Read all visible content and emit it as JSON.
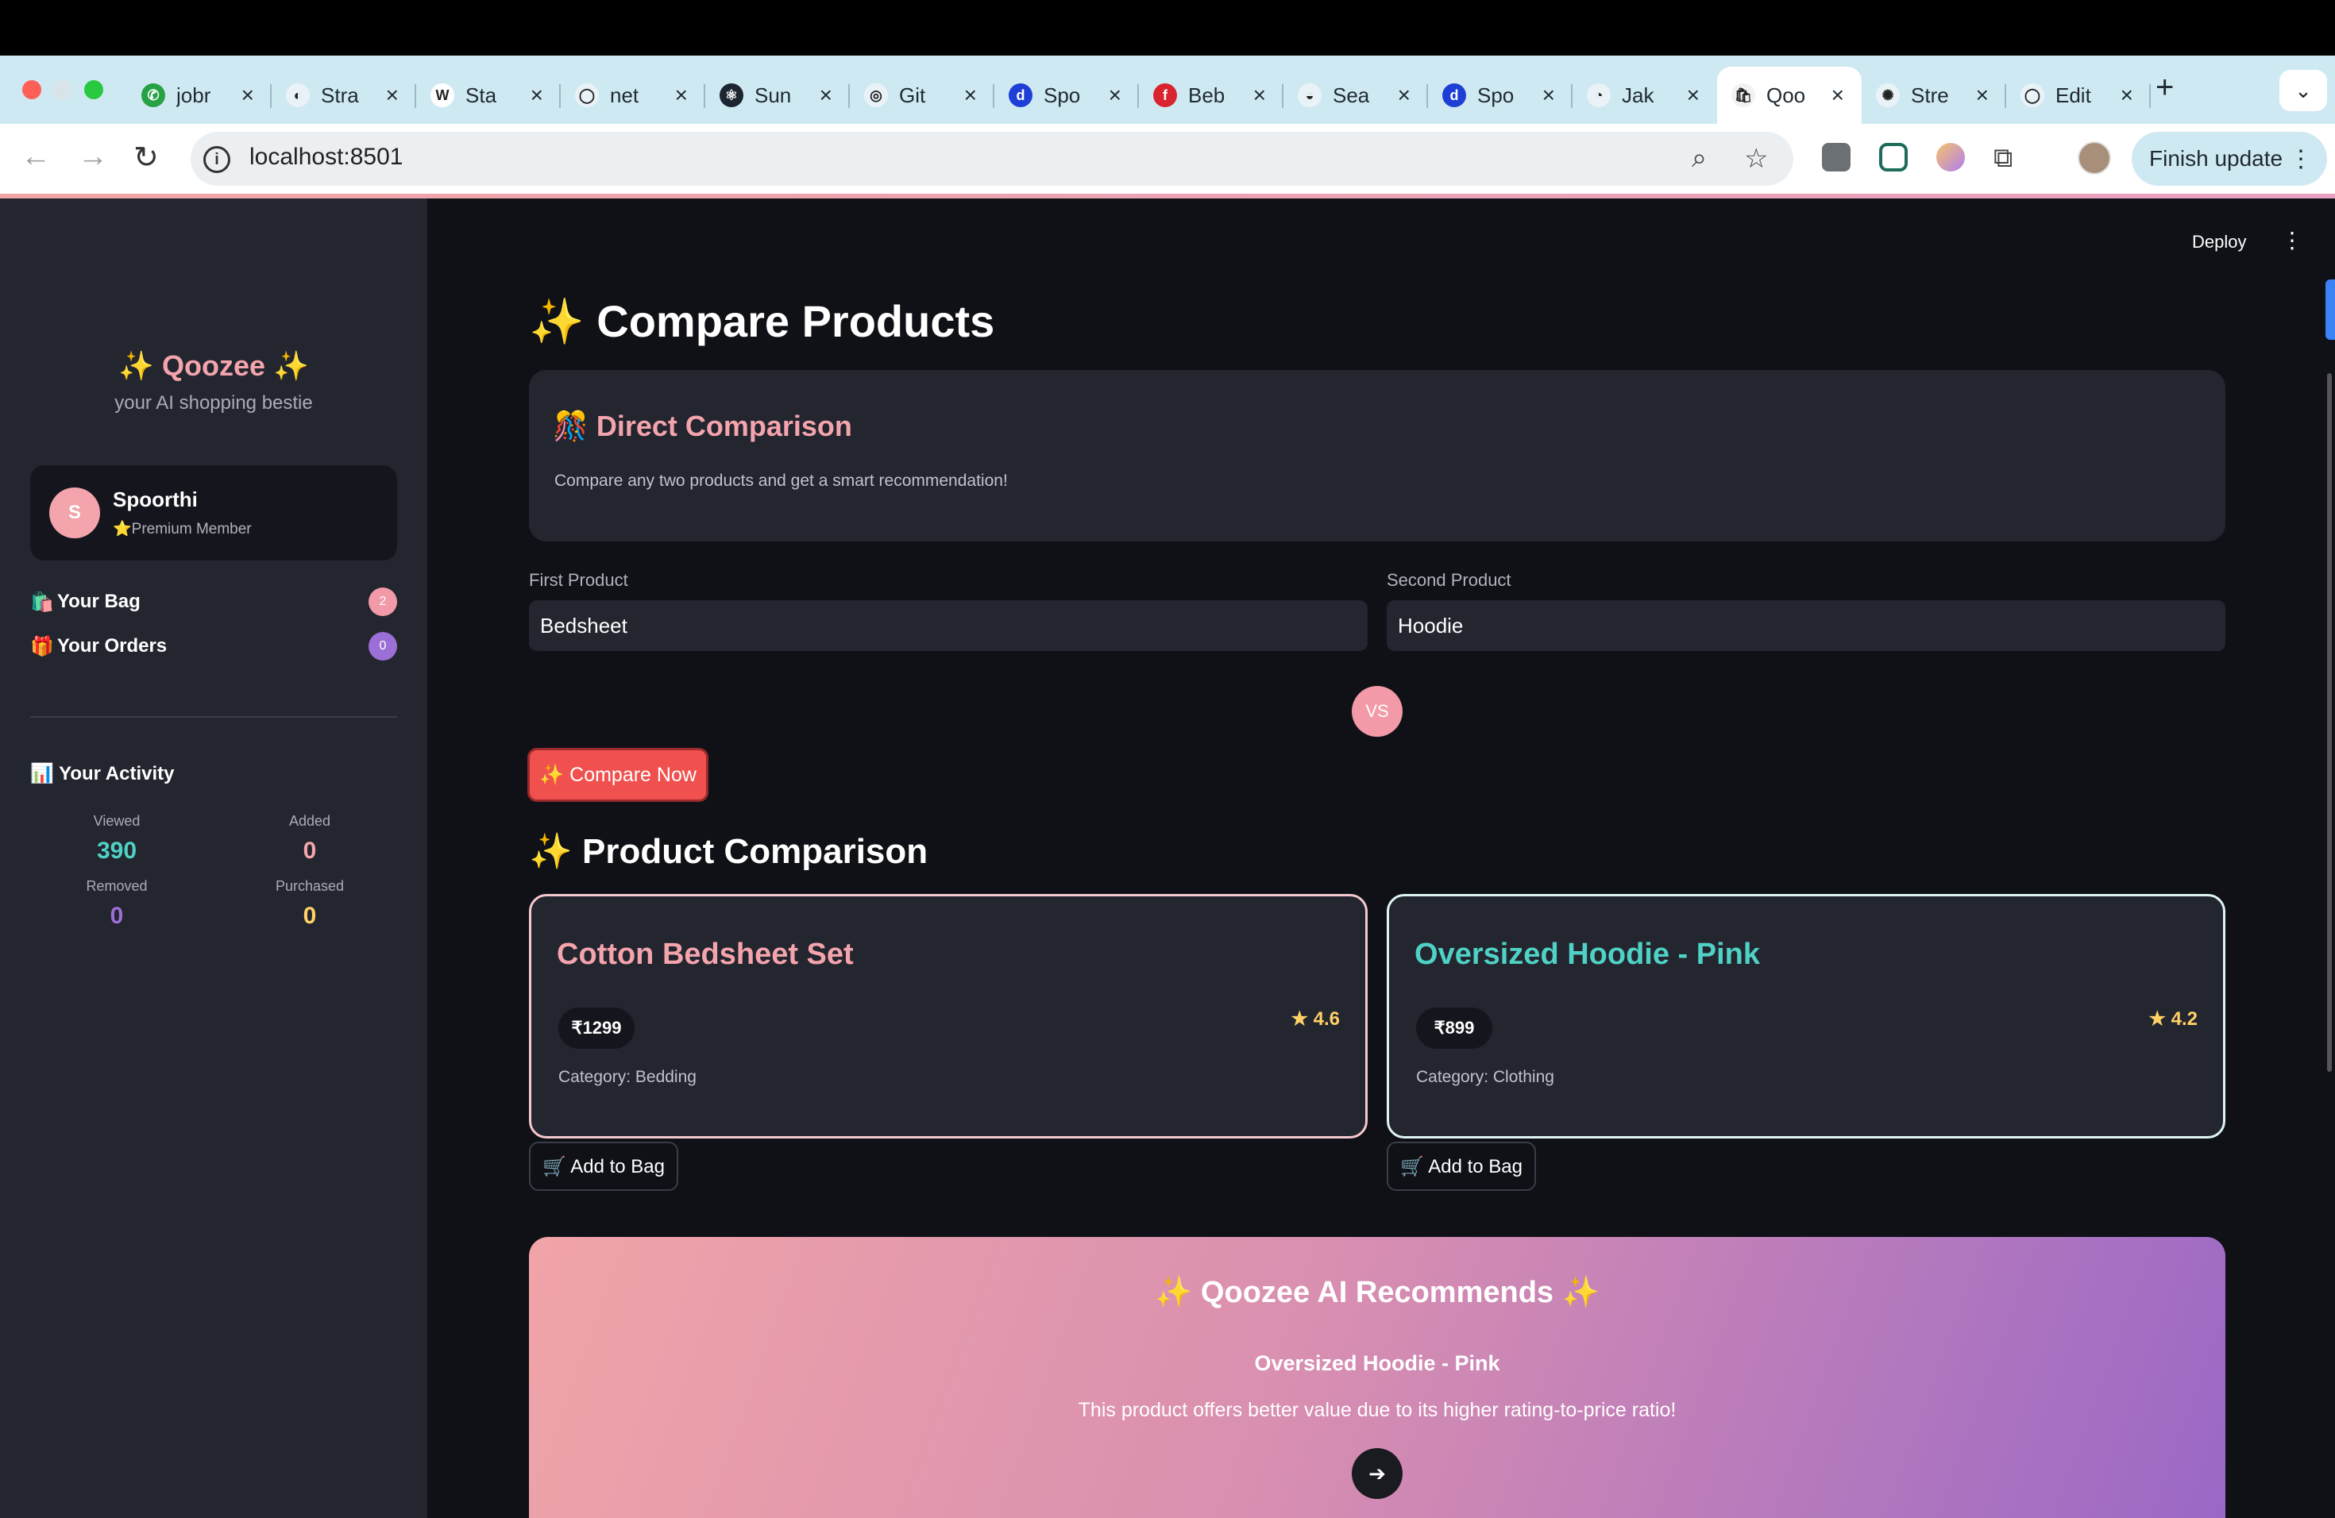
{
  "browser": {
    "tabs": [
      {
        "title": "jobr",
        "fav_bg": "#25a244",
        "fav_glyph": "✆"
      },
      {
        "title": "Stra",
        "fav_bg": "#e9f3f7",
        "fav_glyph": "◐"
      },
      {
        "title": "Sta",
        "fav_bg": "#ffffff",
        "fav_glyph": "W"
      },
      {
        "title": "net",
        "fav_bg": "#e9f3f7",
        "fav_glyph": "◯"
      },
      {
        "title": "Sun",
        "fav_bg": "#1c2530",
        "fav_glyph": "⚛"
      },
      {
        "title": "Git",
        "fav_bg": "#e9f3f7",
        "fav_glyph": "◎"
      },
      {
        "title": "Spo",
        "fav_bg": "#1d3fd6",
        "fav_glyph": "d"
      },
      {
        "title": "Beb",
        "fav_bg": "#d9232e",
        "fav_glyph": "f"
      },
      {
        "title": "Sea",
        "fav_bg": "#e9f3f7",
        "fav_glyph": "◒"
      },
      {
        "title": "Spo",
        "fav_bg": "#1d3fd6",
        "fav_glyph": "d"
      },
      {
        "title": "Jak",
        "fav_bg": "#e9f3f7",
        "fav_glyph": "◔"
      },
      {
        "title": "Qoo",
        "fav_bg": "#f2f2f2",
        "fav_glyph": "🛍"
      },
      {
        "title": "Stre",
        "fav_bg": "#e9f3f7",
        "fav_glyph": "✺"
      },
      {
        "title": "Edit",
        "fav_bg": "#e9f3f7",
        "fav_glyph": "◯"
      }
    ],
    "active_tab_index": 11,
    "url": "localhost:8501",
    "update_label": "Finish update"
  },
  "sidebar": {
    "brand": "✨ Qoozee ✨",
    "tagline": "your AI shopping bestie",
    "user": {
      "initial": "S",
      "name": "Spoorthi",
      "role": "⭐Premium Member"
    },
    "nav": [
      {
        "icon": "🛍️",
        "label": "Your Bag",
        "count": "2",
        "badge_color": "#f29aa7"
      },
      {
        "icon": "🎁",
        "label": "Your Orders",
        "count": "0",
        "badge_color": "#9b6fd6"
      }
    ],
    "activity": {
      "title": "📊 Your Activity",
      "stats": [
        {
          "label": "Viewed",
          "value": "390",
          "color": "#4fd1c5"
        },
        {
          "label": "Added",
          "value": "0",
          "color": "#f4a4ac"
        },
        {
          "label": "Removed",
          "value": "0",
          "color": "#9b6fd6"
        },
        {
          "label": "Purchased",
          "value": "0",
          "color": "#ffd166"
        }
      ]
    }
  },
  "main": {
    "deploy_label": "Deploy",
    "title": "✨ Compare Products",
    "direct": {
      "title": "🎊 Direct Comparison",
      "subtitle": "Compare any two products and get a smart recommendation!"
    },
    "first_label": "First Product",
    "first_value": "Bedsheet",
    "second_label": "Second Product",
    "second_value": "Hoodie",
    "vs_label": "VS",
    "compare_label": "✨ Compare Now",
    "comparison_title": "✨ Product Comparison",
    "products": [
      {
        "name": "Cotton Bedsheet Set",
        "price": "₹1299",
        "rating": "4.6",
        "category": "Category: Bedding",
        "name_color": "#f4a4ac"
      },
      {
        "name": "Oversized Hoodie - Pink",
        "price": "₹899",
        "rating": "4.2",
        "category": "Category: Clothing",
        "name_color": "#4fd1c5"
      }
    ],
    "add_to_bag_label": "🛒 Add to Bag",
    "recommendation": {
      "title": "✨ Qoozee AI Recommends ✨",
      "product": "Oversized Hoodie - Pink",
      "reason": "This product offers better value due to its higher rating-to-price ratio!",
      "arrow": "➔"
    }
  }
}
